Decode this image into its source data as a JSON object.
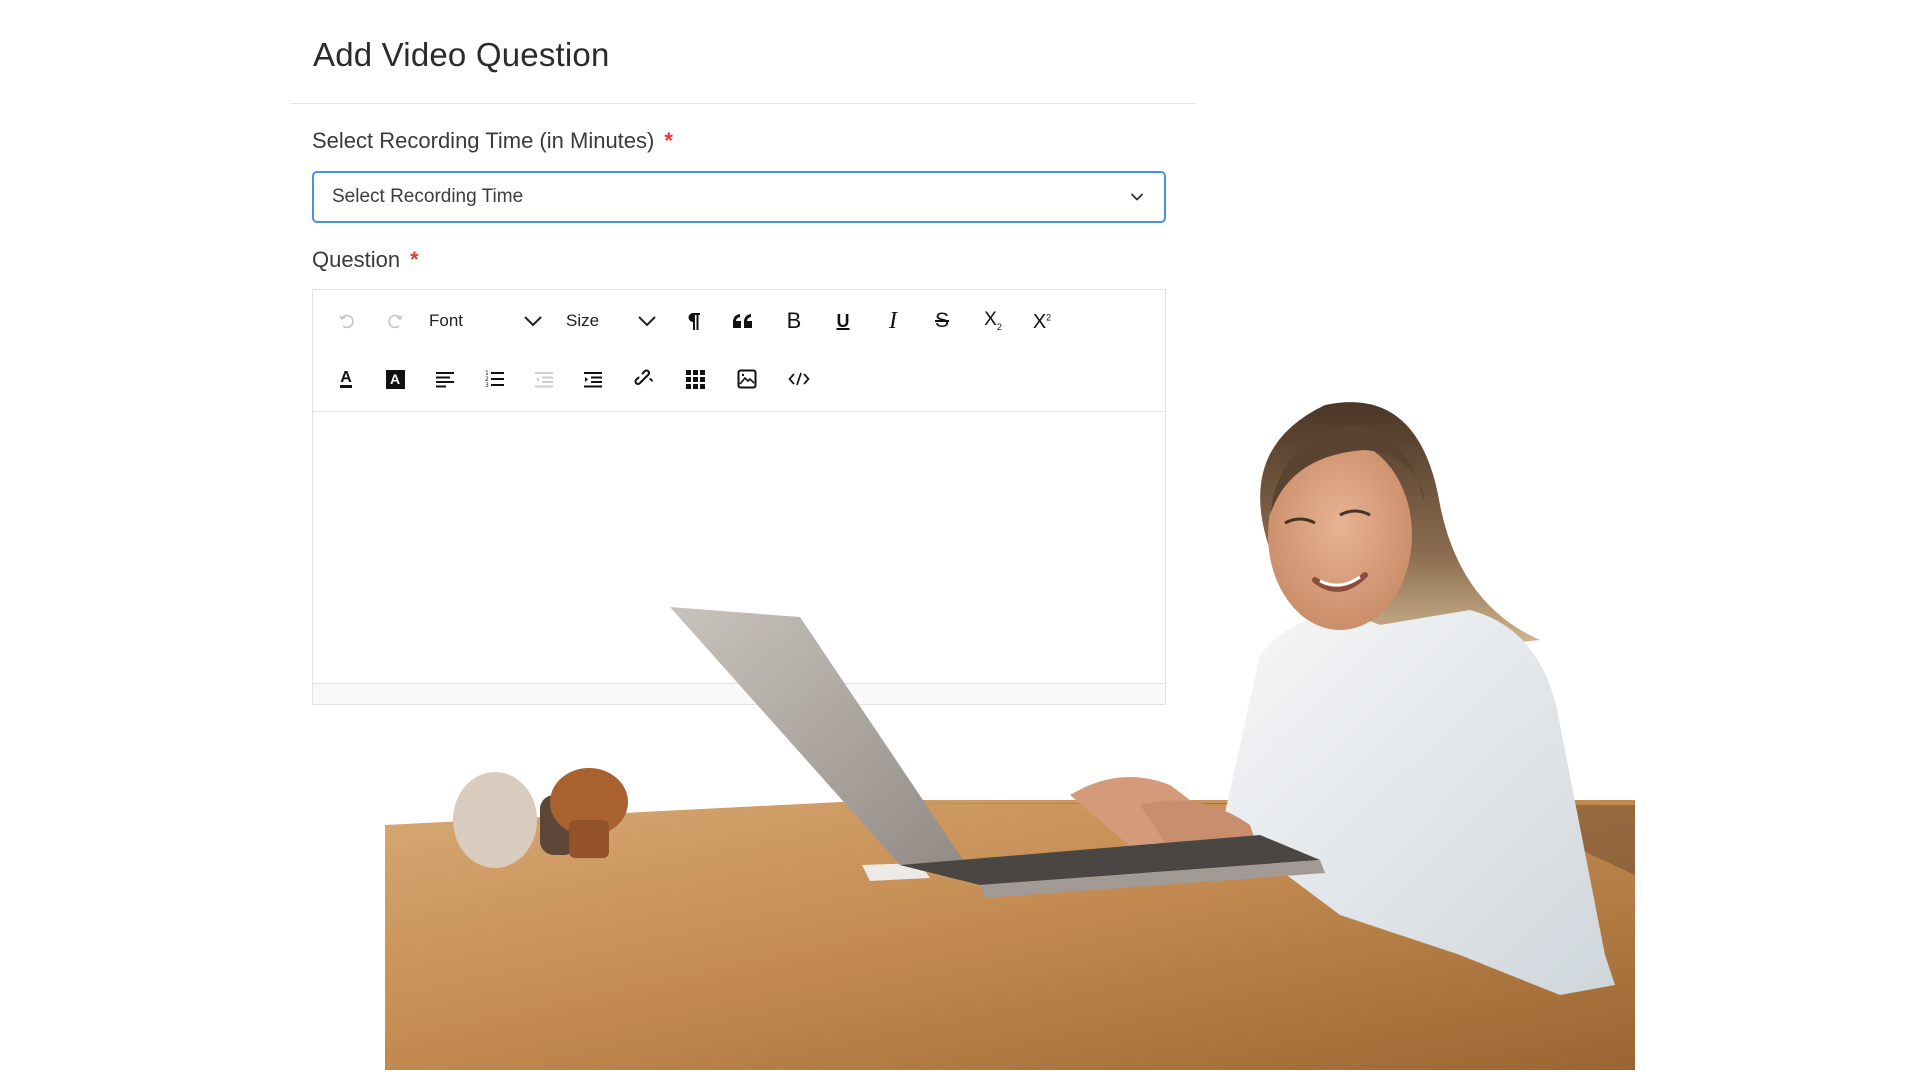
{
  "page": {
    "title": "Add Video Question"
  },
  "recording_time": {
    "label": "Select Recording Time (in Minutes)",
    "required_mark": "*",
    "placeholder": "Select Recording Time",
    "icon": "chevron-down-icon",
    "border_color": "#4a8fe7"
  },
  "question": {
    "label": "Question",
    "required_mark": "*",
    "content": ""
  },
  "editor_toolbar": {
    "row1": [
      {
        "name": "undo",
        "icon": "undo-icon",
        "enabled": false
      },
      {
        "name": "redo",
        "icon": "redo-icon",
        "enabled": false
      },
      {
        "name": "font",
        "label": "Font",
        "icon": "chevron-down-icon"
      },
      {
        "name": "size",
        "label": "Size",
        "icon": "chevron-down-icon"
      },
      {
        "name": "paragraph",
        "icon": "pilcrow-icon"
      },
      {
        "name": "blockquote",
        "icon": "quote-icon"
      },
      {
        "name": "bold",
        "icon": "bold-icon",
        "glyph": "B"
      },
      {
        "name": "underline",
        "icon": "underline-icon",
        "glyph": "U"
      },
      {
        "name": "italic",
        "icon": "italic-icon",
        "glyph": "I"
      },
      {
        "name": "strikethrough",
        "icon": "strikethrough-icon",
        "glyph": "S"
      },
      {
        "name": "subscript",
        "icon": "subscript-icon",
        "glyph": "X",
        "sub": "2"
      },
      {
        "name": "superscript",
        "icon": "superscript-icon",
        "glyph": "X",
        "sup": "2"
      }
    ],
    "row2": [
      {
        "name": "font-color",
        "icon": "font-color-icon",
        "glyph": "A"
      },
      {
        "name": "highlight-color",
        "icon": "highlight-color-icon",
        "glyph": "A"
      },
      {
        "name": "align",
        "icon": "align-left-icon"
      },
      {
        "name": "list",
        "icon": "ordered-list-icon"
      },
      {
        "name": "outdent",
        "icon": "outdent-icon",
        "enabled": false
      },
      {
        "name": "indent",
        "icon": "indent-icon"
      },
      {
        "name": "link",
        "icon": "link-icon"
      },
      {
        "name": "table",
        "icon": "table-icon"
      },
      {
        "name": "image",
        "icon": "image-icon"
      },
      {
        "name": "code-view",
        "icon": "code-icon"
      }
    ]
  },
  "illustration": {
    "description": "woman typing on laptop at wooden table",
    "icon": "illustration-photo"
  }
}
